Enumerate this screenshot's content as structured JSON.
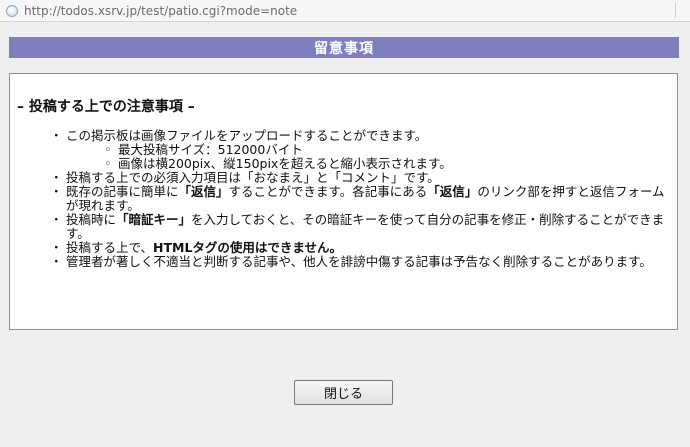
{
  "address_bar": {
    "icon": "page-icon",
    "url": "http://todos.xsrv.jp/test/patio.cgi?mode=note"
  },
  "header": {
    "title": "留意事項"
  },
  "notice": {
    "title": "– 投稿する上での注意事項 –",
    "items": {
      "i0": {
        "text": "この掲示板は画像ファイルをアップロードすることができます。"
      },
      "s0": {
        "text": "最大投稿サイズ：512000バイト"
      },
      "s1": {
        "text": "画像は横200pix、縦150pixを超えると縮小表示されます。"
      },
      "i1": {
        "text": "投稿する上での必須入力項目は「おなまえ」と「コメント」です。"
      },
      "i2": {
        "a": "既存の記事に簡単に",
        "b": "「返信」",
        "c": "することができます。各記事にある",
        "d": "「返信」",
        "e": "のリンク部を押すと返信フォームが現れます。"
      },
      "i3": {
        "a": "投稿時に",
        "b": "「暗証キー」",
        "c": "を入力しておくと、その暗証キーを使って自分の記事を修正・削除することができます。"
      },
      "i4": {
        "a": "投稿する上で、",
        "b": "HTMLタグの使用はできません。"
      },
      "i5": {
        "text": "管理者が著しく不適当と判断する記事や、他人を誹謗中傷する記事は予告なく削除することがあります。"
      }
    }
  },
  "footer": {
    "close_label": "閉じる"
  },
  "colors": {
    "header_bg": "#7f7fbf",
    "panel_border": "#8a8ac8",
    "page_bg": "#efefef"
  }
}
